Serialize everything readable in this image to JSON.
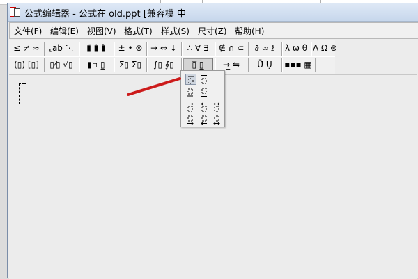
{
  "window": {
    "title": "公式编辑器 - 公式在 old.ppt [兼容模 中"
  },
  "menu": [
    {
      "label": "文件(F)"
    },
    {
      "label": "编辑(E)"
    },
    {
      "label": "视图(V)"
    },
    {
      "label": "格式(T)"
    },
    {
      "label": "样式(S)"
    },
    {
      "label": "尺寸(Z)"
    },
    {
      "label": "帮助(H)"
    }
  ],
  "toolbar_row1": [
    {
      "label": "≤ ≠ ≈",
      "icon": "relational-symbols-icon"
    },
    {
      "label": "⸤ab ⋱",
      "icon": "spaces-ellipses-icon"
    },
    {
      "label": "▮̈ ▮̇ ▮̃",
      "icon": "embellishments-icon"
    },
    {
      "label": "± • ⊗",
      "icon": "operator-symbols-icon"
    },
    {
      "label": "→ ⇔ ↓",
      "icon": "arrow-symbols-icon"
    },
    {
      "label": "∴ ∀ ∃",
      "icon": "logical-symbols-icon"
    },
    {
      "label": "∉ ∩ ⊂",
      "icon": "set-theory-symbols-icon"
    },
    {
      "label": "∂ ∞ ℓ",
      "icon": "miscellaneous-symbols-icon"
    },
    {
      "label": "λ ω θ",
      "icon": "greek-lowercase-icon"
    },
    {
      "label": "Λ Ω ⊛",
      "icon": "greek-uppercase-icon"
    }
  ],
  "toolbar_row2": [
    {
      "label": "(▯) [▯]",
      "icon": "fence-templates-icon"
    },
    {
      "label": "▯⁄▯ √▯",
      "icon": "fraction-radical-templates-icon"
    },
    {
      "label": "▮▫ ▯̲",
      "icon": "subscript-superscript-templates-icon"
    },
    {
      "label": "Σ▯ Σ▯",
      "icon": "summation-templates-icon"
    },
    {
      "label": "∫▯ ∮▯",
      "icon": "integral-templates-icon"
    },
    {
      "label": "▯̅ ▯̲",
      "icon": "underbar-overbar-templates-icon"
    },
    {
      "label": "→̲ ⇋",
      "icon": "labeled-arrow-templates-icon"
    },
    {
      "label": "Ū̇ Ụ",
      "icon": "products-set-theory-templates-icon"
    },
    {
      "label": "▪▪▪ ▦",
      "icon": "matrix-templates-icon"
    }
  ],
  "popup_palette": {
    "items": [
      {
        "icon": "overbar-single-template-icon"
      },
      {
        "icon": "overbar-double-template-icon"
      },
      {
        "icon": "underbar-single-template-icon"
      },
      {
        "icon": "underbar-double-template-icon"
      },
      {
        "icon": "right-arrow-over-template-icon"
      },
      {
        "icon": "left-arrow-over-template-icon"
      },
      {
        "icon": "double-arrow-over-template-icon"
      },
      {
        "icon": "right-arrow-under-template-icon"
      },
      {
        "icon": "left-arrow-under-template-icon"
      },
      {
        "icon": "double-arrow-under-template-icon"
      }
    ],
    "selected_index": 0
  },
  "colors": {
    "annotation_arrow": "#cc1a1a",
    "titlebar": "#c7d7ec",
    "workspace": "#ececec"
  }
}
